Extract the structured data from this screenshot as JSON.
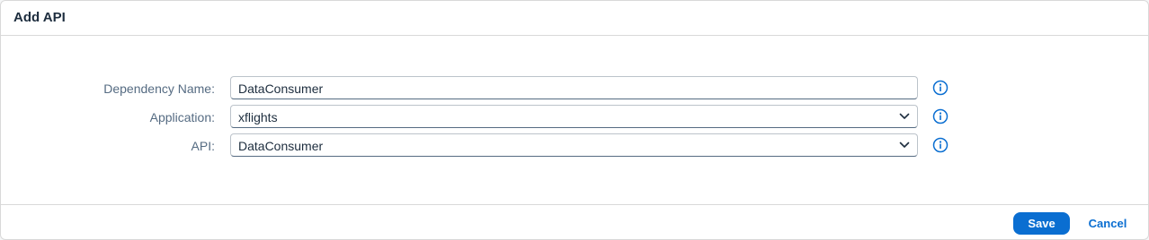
{
  "dialog": {
    "title": "Add API"
  },
  "form": {
    "fields": [
      {
        "label": "Dependency Name:",
        "value": "DataConsumer",
        "type": "text"
      },
      {
        "label": "Application:",
        "value": "xflights",
        "type": "select"
      },
      {
        "label": "API:",
        "value": "DataConsumer",
        "type": "select"
      }
    ]
  },
  "footer": {
    "save_label": "Save",
    "cancel_label": "Cancel"
  },
  "icons": {
    "info": "info-icon",
    "dropdown": "chevron-down-icon"
  },
  "colors": {
    "accent": "#0a6ed1",
    "label": "#556b82",
    "text": "#1d2d3e"
  }
}
